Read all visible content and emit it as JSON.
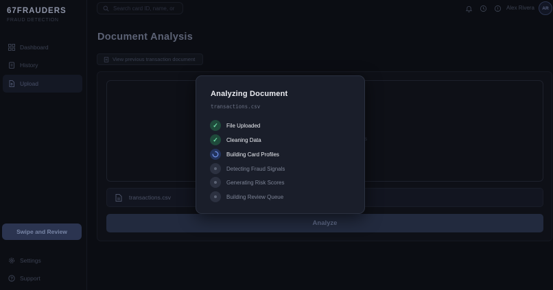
{
  "app": {
    "brand": "67FRAUDERS",
    "brand_sub": "FRAUD DETECTION"
  },
  "sidebar": {
    "items": [
      {
        "label": "Dashboard",
        "icon": "grid-icon"
      },
      {
        "label": "History",
        "icon": "clipboard-icon"
      },
      {
        "label": "Upload",
        "icon": "file-upload-icon",
        "active": true
      }
    ],
    "swipe_button": "Swipe and Review",
    "bottom_items": [
      {
        "label": "Settings",
        "icon": "gear-icon"
      },
      {
        "label": "Support",
        "icon": "help-icon"
      }
    ]
  },
  "topbar": {
    "search_placeholder": "Search card ID, name, or",
    "user_name": "Alex Rivera",
    "user_initials": "AR"
  },
  "main": {
    "title": "Document Analysis",
    "prev_button": "View previous transaction document",
    "dropzone_visible_text": "s",
    "file_name": "transactions.csv",
    "analyze_button": "Analyze"
  },
  "modal": {
    "title": "Analyzing Document",
    "file": "transactions.csv",
    "steps": [
      {
        "label": "File Uploaded",
        "status": "done"
      },
      {
        "label": "Cleaning Data",
        "status": "done"
      },
      {
        "label": "Building Card Profiles",
        "status": "active"
      },
      {
        "label": "Detecting Fraud Signals",
        "status": "pending"
      },
      {
        "label": "Generating Risk Scores",
        "status": "pending"
      },
      {
        "label": "Building Review Queue",
        "status": "pending"
      }
    ]
  },
  "colors": {
    "background": "#0b0d13",
    "modal_bg": "#1a1e2a",
    "done_green": "#6fe0a8",
    "active_blue": "#4f6fc7",
    "accent_button": "#2b3450"
  }
}
